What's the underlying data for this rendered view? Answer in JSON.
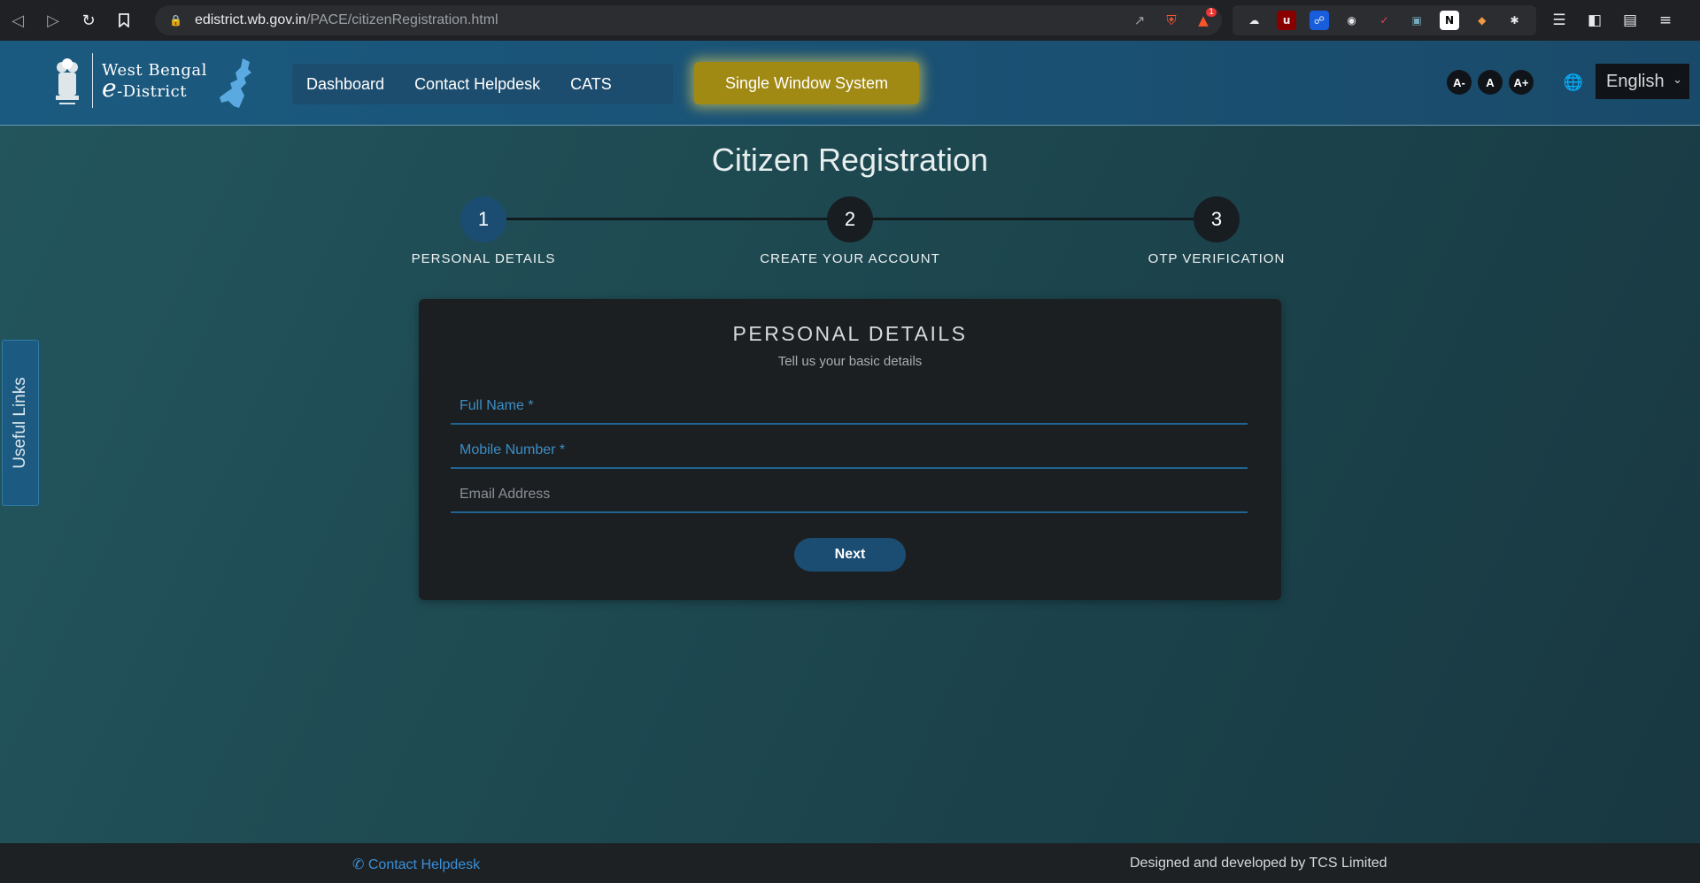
{
  "browser": {
    "url_domain": "edistrict.wb.gov.in",
    "url_path": "/PACE/citizenRegistration.html",
    "brave_badge": "1"
  },
  "header": {
    "logo_line1": "West Bengal",
    "logo_line2_big": "e",
    "logo_line2_rest": "-District",
    "nav": [
      "Dashboard",
      "Contact Helpdesk",
      "CATS"
    ],
    "highlight_button": "Single Window System",
    "font_decrease": "A-",
    "font_normal": "A",
    "font_increase": "A+",
    "language": "English"
  },
  "page": {
    "title": "Citizen Registration",
    "steps": [
      {
        "number": "1",
        "label": "PERSONAL DETAILS"
      },
      {
        "number": "2",
        "label": "CREATE YOUR ACCOUNT"
      },
      {
        "number": "3",
        "label": "OTP VERIFICATION"
      }
    ],
    "active_step": 1
  },
  "form": {
    "title": "PERSONAL DETAILS",
    "subtitle": "Tell us your basic details",
    "fields": [
      {
        "label": "Full Name *"
      },
      {
        "label": "Mobile Number *"
      },
      {
        "label": "Email Address"
      }
    ],
    "submit": "Next"
  },
  "side_tab": "Useful Links",
  "footer": {
    "contact": "Contact Helpdesk",
    "credit": "Designed and developed by TCS Limited"
  },
  "colors": {
    "primary": "#1b4d72",
    "accent_gold": "#a08a14",
    "link": "#3a8fd8"
  }
}
